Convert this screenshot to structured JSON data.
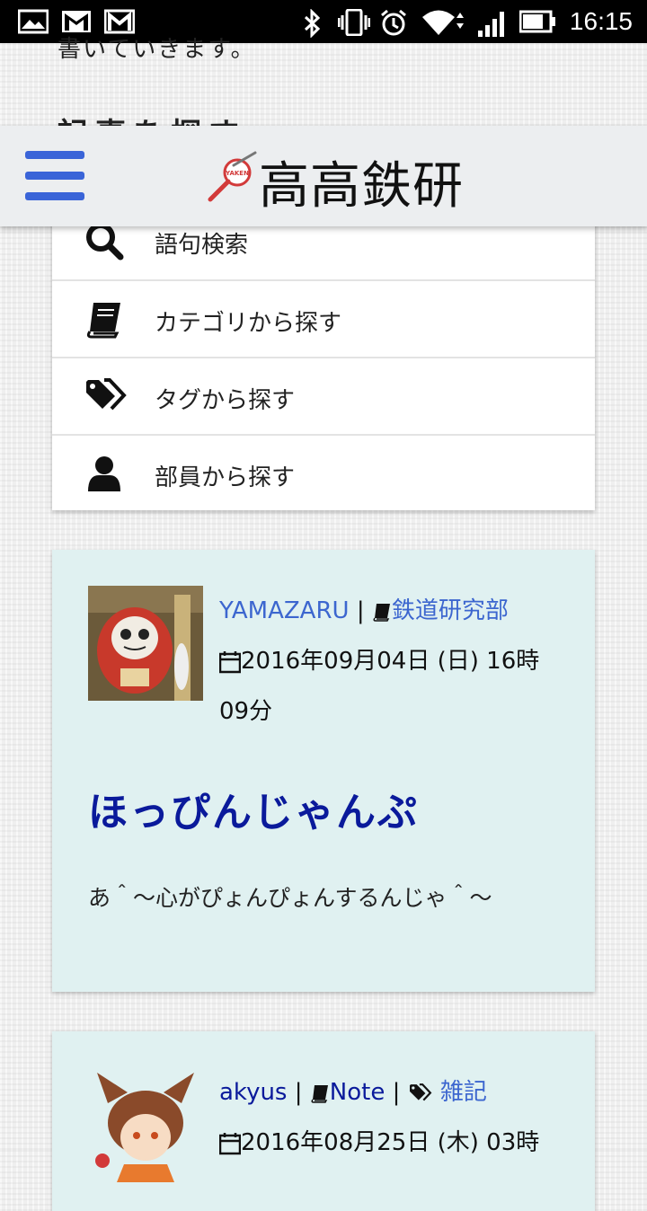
{
  "status_bar": {
    "time": "16:15",
    "icons": [
      "gallery-icon",
      "gmail-icon",
      "gmail-icon",
      "bluetooth-icon",
      "vibrate-icon",
      "alarm-icon",
      "wifi-icon",
      "signal-icon",
      "battery-icon"
    ]
  },
  "page_peek": {
    "line1": "書いていきます。",
    "line2": "記事を探す"
  },
  "header": {
    "menu_icon": "hamburger-icon",
    "logo_icon": "magnifier-logo-icon",
    "logo_text": "YAKEN",
    "title": "高高鉄研",
    "accent": "#3a64d8"
  },
  "search_menu": {
    "items": [
      {
        "icon": "search-icon",
        "label": "語句検索"
      },
      {
        "icon": "book-icon",
        "label": "カテゴリから探す"
      },
      {
        "icon": "tags-icon",
        "label": "タグから探す"
      },
      {
        "icon": "user-icon",
        "label": "部員から探す"
      }
    ]
  },
  "posts": [
    {
      "author": "YAMAZARU",
      "category": "鉄道研究部",
      "tag": "",
      "date_line1": "2016年09月04日 (日) 16時",
      "date_line2": "09分",
      "title": "ほっぴんじゃんぷ",
      "excerpt": "あ＾〜心がぴょんぴょんするんじゃ＾〜"
    },
    {
      "author": "akyus",
      "category": "Note",
      "tag": "雑記",
      "date_line1": "2016年08月25日 (木) 03時",
      "date_line2": "",
      "title": "",
      "excerpt": ""
    }
  ],
  "colors": {
    "card_bg": "#e0f1f1",
    "link": "#3c66cf",
    "title": "#0a1a9b"
  }
}
